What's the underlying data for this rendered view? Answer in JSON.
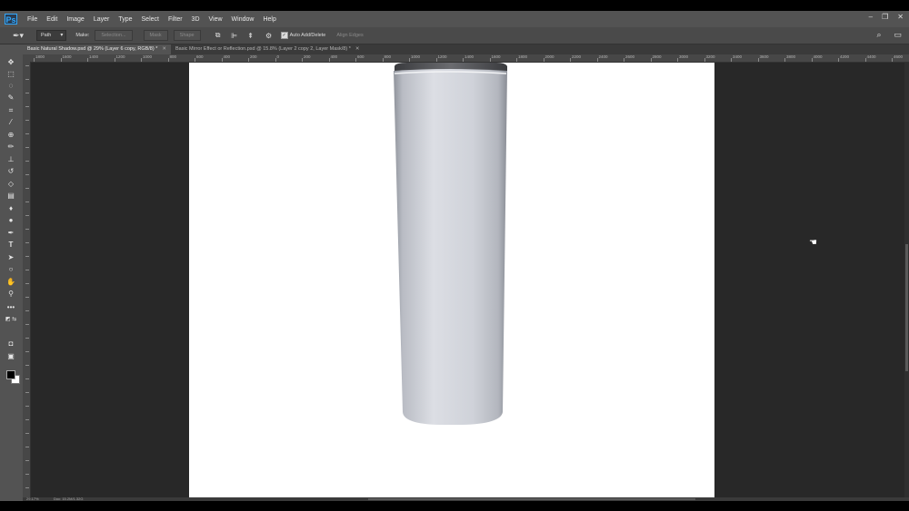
{
  "app": {
    "logo": "Ps"
  },
  "menu": [
    "File",
    "Edit",
    "Image",
    "Layer",
    "Type",
    "Select",
    "Filter",
    "3D",
    "View",
    "Window",
    "Help"
  ],
  "window_controls": [
    "–",
    "❐",
    "✕"
  ],
  "options": {
    "tool_preset_icon": "pen-icon",
    "mode": "Path",
    "make_label": "Make:",
    "selection_btn": "Selection...",
    "mask_btn": "Mask",
    "shape_btn": "Shape",
    "auto_add_delete": "Auto Add/Delete",
    "align_edges": "Align Edges"
  },
  "tabs": [
    {
      "label": "Basic Natural Shadow.psd @ 29% (Layer 6 copy, RGB/8) *",
      "active": true
    },
    {
      "label": "Basic Mirror Effect or Reflection.psd @ 15.8% (Layer 2 copy 2, Layer Mask/8) *",
      "active": false
    }
  ],
  "ruler_labels": [
    "1800",
    "1600",
    "1400",
    "1200",
    "1000",
    "800",
    "600",
    "400",
    "200",
    "0",
    "200",
    "400",
    "600",
    "800",
    "1000",
    "1200",
    "1400",
    "1600",
    "1800",
    "2000",
    "2200",
    "2400",
    "2600",
    "2800",
    "3000",
    "3200",
    "3400",
    "3600",
    "3800",
    "4000",
    "4200",
    "4400",
    "4600",
    "4800",
    "5000"
  ],
  "status": {
    "zoom": "29.17%",
    "doc": "Doc: 15.2M/1.32G"
  },
  "colors": {
    "bottle_body": "#cdd0d8",
    "bottle_cap": "#5a5b5e",
    "panel": "#535353",
    "workspace": "#282828"
  }
}
